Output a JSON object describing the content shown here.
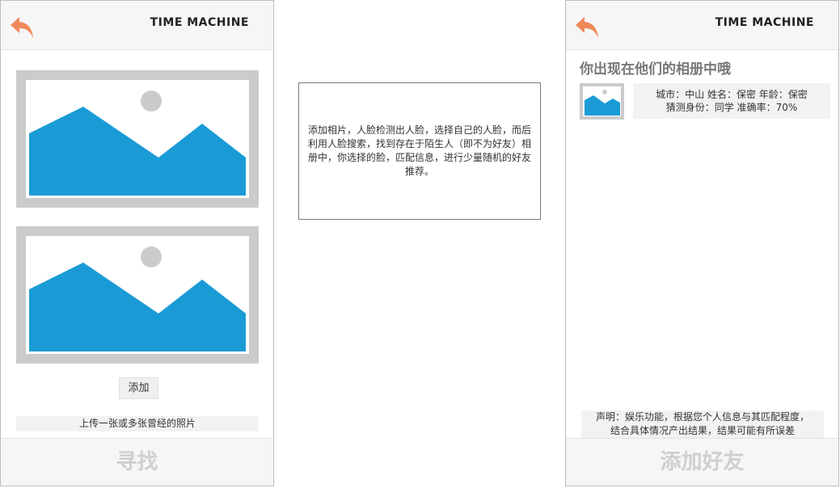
{
  "left_screen": {
    "brand": "TIME MACHINE",
    "add_button": "添加",
    "upload_hint": "上传一张或多张曾经的照片",
    "footer_button": "寻找"
  },
  "description": "添加相片，人脸检测出人脸，选择自己的人脸，而后利用人脸搜索，找到存在于陌生人（即不为好友）相册中，你选择的脸，匹配信息，进行少量随机的好友推荐。",
  "right_screen": {
    "brand": "TIME MACHINE",
    "result_title": "你出现在他们的相册中哦",
    "match": {
      "line1": "城市：中山 姓名：保密 年龄：保密",
      "line2": "猜测身份：同学 准确率：70%"
    },
    "disclaimer": {
      "line1": "声明：娱乐功能，根据您个人信息与其匹配程度，",
      "line2": "结合具体情况产出结果，结果可能有所误差"
    },
    "footer_button": "添加好友"
  },
  "colors": {
    "accent_orange": "#f0895a",
    "image_blue": "#1a9bd6",
    "placeholder_gray": "#cbcbcb",
    "footer_text": "#cfcfcf"
  },
  "icons": {
    "back": "back-arrow-icon",
    "image": "image-placeholder-icon"
  }
}
